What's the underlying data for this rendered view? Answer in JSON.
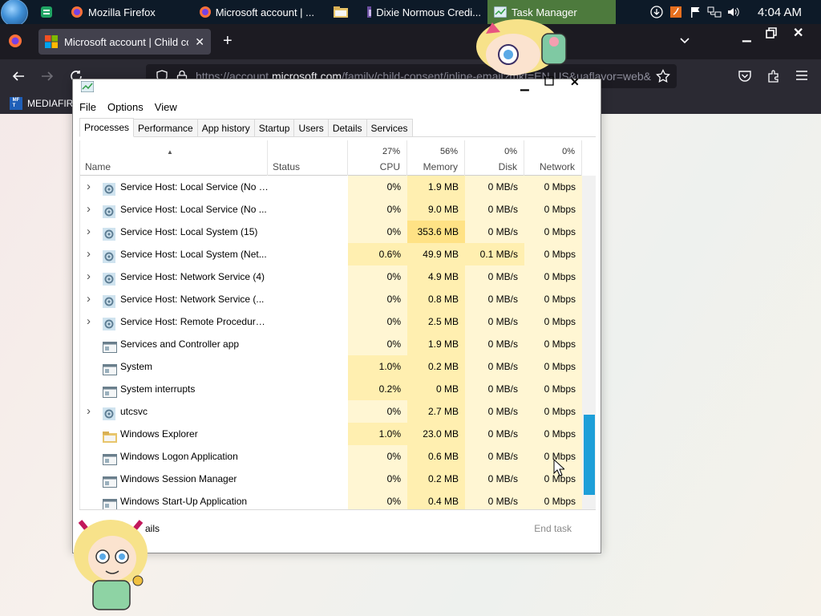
{
  "taskbar": {
    "tasks": [
      {
        "label": "",
        "icon": "sheets-icon"
      },
      {
        "label": "Mozilla Firefox",
        "icon": "firefox-icon"
      },
      {
        "label": "Microsoft account | ...",
        "icon": "firefox-icon"
      },
      {
        "label": "",
        "icon": "folder-icon"
      },
      {
        "label": "Dixie Normous Credi...",
        "icon": "window-icon"
      },
      {
        "label": "Task Manager",
        "icon": "task-manager-icon"
      }
    ],
    "clock": "4:04 AM"
  },
  "firefox": {
    "tab_title": "Microsoft account | Child consent",
    "url_prefix": "https://account.",
    "url_host": "microsoft.com",
    "url_rest": "/family/child-consent/inline-email?mkt=EN-US&uaflavor=web&",
    "bookmark": "MEDIAFIRE F"
  },
  "taskmanager": {
    "menu": [
      "File",
      "Options",
      "View"
    ],
    "tabs": [
      "Processes",
      "Performance",
      "App history",
      "Startup",
      "Users",
      "Details",
      "Services"
    ],
    "columns": {
      "name": "Name",
      "status": "Status",
      "cpu": {
        "pct": "27%",
        "label": "CPU"
      },
      "memory": {
        "pct": "56%",
        "label": "Memory"
      },
      "disk": {
        "pct": "0%",
        "label": "Disk"
      },
      "network": {
        "pct": "0%",
        "label": "Network"
      }
    },
    "rows": [
      {
        "expand": true,
        "icon": "gear",
        "name": "Service Host: Local Service (No I...",
        "cpu": "0%",
        "memory": "1.9 MB",
        "disk": "0 MB/s",
        "network": "0 Mbps"
      },
      {
        "expand": true,
        "icon": "gear",
        "name": "Service Host: Local Service (No ...",
        "cpu": "0%",
        "memory": "9.0 MB",
        "disk": "0 MB/s",
        "network": "0 Mbps"
      },
      {
        "expand": true,
        "icon": "gear",
        "name": "Service Host: Local System (15)",
        "cpu": "0%",
        "memory": "353.6 MB",
        "disk": "0 MB/s",
        "network": "0 Mbps"
      },
      {
        "expand": true,
        "icon": "gear",
        "name": "Service Host: Local System (Net...",
        "cpu": "0.6%",
        "memory": "49.9 MB",
        "disk": "0.1 MB/s",
        "network": "0 Mbps"
      },
      {
        "expand": true,
        "icon": "gear",
        "name": "Service Host: Network Service (4)",
        "cpu": "0%",
        "memory": "4.9 MB",
        "disk": "0 MB/s",
        "network": "0 Mbps"
      },
      {
        "expand": true,
        "icon": "gear",
        "name": "Service Host: Network Service (...",
        "cpu": "0%",
        "memory": "0.8 MB",
        "disk": "0 MB/s",
        "network": "0 Mbps"
      },
      {
        "expand": true,
        "icon": "gear",
        "name": "Service Host: Remote Procedure...",
        "cpu": "0%",
        "memory": "2.5 MB",
        "disk": "0 MB/s",
        "network": "0 Mbps"
      },
      {
        "expand": false,
        "icon": "app",
        "name": "Services and Controller app",
        "cpu": "0%",
        "memory": "1.9 MB",
        "disk": "0 MB/s",
        "network": "0 Mbps"
      },
      {
        "expand": false,
        "icon": "app",
        "name": "System",
        "cpu": "1.0%",
        "memory": "0.2 MB",
        "disk": "0 MB/s",
        "network": "0 Mbps"
      },
      {
        "expand": false,
        "icon": "app",
        "name": "System interrupts",
        "cpu": "0.2%",
        "memory": "0 MB",
        "disk": "0 MB/s",
        "network": "0 Mbps"
      },
      {
        "expand": true,
        "icon": "gear",
        "name": "utcsvc",
        "cpu": "0%",
        "memory": "2.7 MB",
        "disk": "0 MB/s",
        "network": "0 Mbps"
      },
      {
        "expand": false,
        "icon": "folder",
        "name": "Windows Explorer",
        "cpu": "1.0%",
        "memory": "23.0 MB",
        "disk": "0 MB/s",
        "network": "0 Mbps"
      },
      {
        "expand": false,
        "icon": "app",
        "name": "Windows Logon Application",
        "cpu": "0%",
        "memory": "0.6 MB",
        "disk": "0 MB/s",
        "network": "0 Mbps"
      },
      {
        "expand": false,
        "icon": "app",
        "name": "Windows Session Manager",
        "cpu": "0%",
        "memory": "0.2 MB",
        "disk": "0 MB/s",
        "network": "0 Mbps"
      },
      {
        "expand": false,
        "icon": "app",
        "name": "Windows Start-Up Application",
        "cpu": "0%",
        "memory": "0.4 MB",
        "disk": "0 MB/s",
        "network": "0 Mbps"
      }
    ],
    "footer": {
      "fewer_details": "ails",
      "end_task": "End task"
    }
  },
  "colors": {
    "taskbar_bg": "#0d1a28",
    "active_task": "#4d7a3d",
    "heat_light": "#fff6d3",
    "heat_medium": "#ffefb0",
    "heat_strong": "#ffe285",
    "scroll_thumb": "#1e9fd8"
  }
}
